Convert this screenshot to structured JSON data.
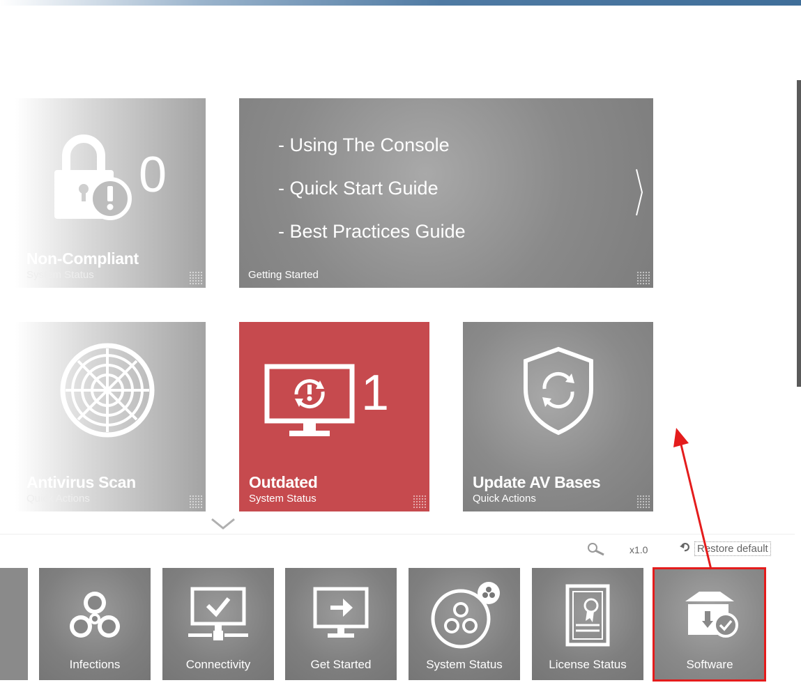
{
  "tiles": {
    "non_compliant": {
      "count": "0",
      "title": "Non-Compliant",
      "subtitle": "System Status"
    },
    "getting_started": {
      "links": [
        "- Using The Console",
        "- Quick Start Guide",
        "- Best Practices Guide"
      ],
      "subtitle": "Getting Started"
    },
    "antivirus_scan": {
      "title": "Antivirus Scan",
      "subtitle": "Quick Actions"
    },
    "outdated": {
      "count": "1",
      "title": "Outdated",
      "subtitle": "System Status"
    },
    "update_av": {
      "title": "Update AV Bases",
      "subtitle": "Quick Actions"
    }
  },
  "toolbar": {
    "zoom": "x1.0",
    "restore_label": "Restore default"
  },
  "strip": [
    {
      "label": "Infections",
      "icon": "biohazard-icon"
    },
    {
      "label": "Connectivity",
      "icon": "monitor-check-icon"
    },
    {
      "label": "Get Started",
      "icon": "monitor-arrow-icon"
    },
    {
      "label": "System Status",
      "icon": "biohazard-circle-icon"
    },
    {
      "label": "License Status",
      "icon": "certificate-icon"
    },
    {
      "label": "Software",
      "icon": "software-box-icon"
    }
  ],
  "colors": {
    "accent_red": "#c64a4e",
    "highlight": "#e41c1c",
    "tile_grey": "#8a8a8a"
  }
}
